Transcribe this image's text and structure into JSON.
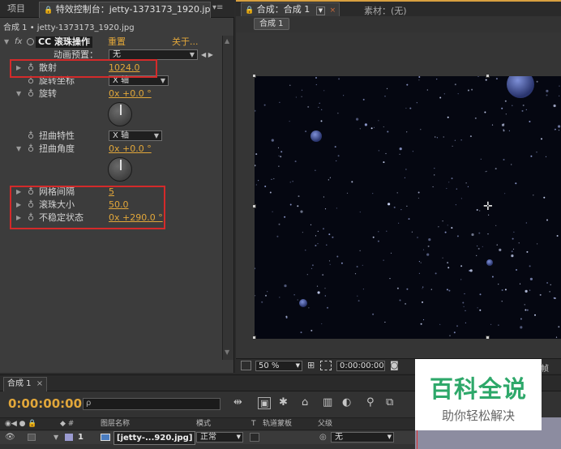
{
  "effect_panel": {
    "tab_project": "项目",
    "tab_effects": "特效控制台：jetty-1373173_1920.jpg",
    "menu_glyph": "▾≡",
    "layer_line": "合成 1 • jetty-1373173_1920.jpg",
    "effect_badge": "fx",
    "effect_name": "CC 滚珠操作",
    "reset_label": "重置",
    "about_label": "关于...",
    "anim_preset_label": "动画预置：",
    "anim_preset_value": "无",
    "params": [
      {
        "label": "散射",
        "value": "1024.0"
      },
      {
        "label": "旋转坐标",
        "value": "X 轴"
      },
      {
        "label": "旋转",
        "value": "0x +0.0 °"
      },
      {
        "label": "扭曲特性",
        "value": "X 轴"
      },
      {
        "label": "扭曲角度",
        "value": "0x +0.0 °"
      },
      {
        "label": "网格间隔",
        "value": "5"
      },
      {
        "label": "滚珠大小",
        "value": "50.0"
      },
      {
        "label": "不稳定状态",
        "value": "0x +290.0 °"
      }
    ]
  },
  "viewer": {
    "tab_comp": "合成：合成 1",
    "tab_footage": "素材：(无)",
    "comp_button": "合成 1",
    "zoom": "50 %",
    "timecode": "0:00:00:00",
    "right_label": "有效帧"
  },
  "timeline": {
    "tab": "合成 1",
    "close": "×",
    "timecode": "0:00:00:00",
    "search_glyph": "ρ",
    "col_layer_name": "图层名称",
    "col_mode": "模式",
    "col_t": "T",
    "col_track_matte": "轨道蒙板",
    "col_parent": "父级",
    "layer_num": "1",
    "layer_name": "[jetty-...920.jpg]",
    "layer_mode": "正常",
    "layer_parent": "无"
  },
  "watermark": {
    "title": "百科全说",
    "subtitle": "助你轻松解决"
  },
  "colors": {
    "accent_orange": "#e2a73a",
    "highlight_red": "#d42a2a",
    "watermark_green": "#2ea86a"
  }
}
